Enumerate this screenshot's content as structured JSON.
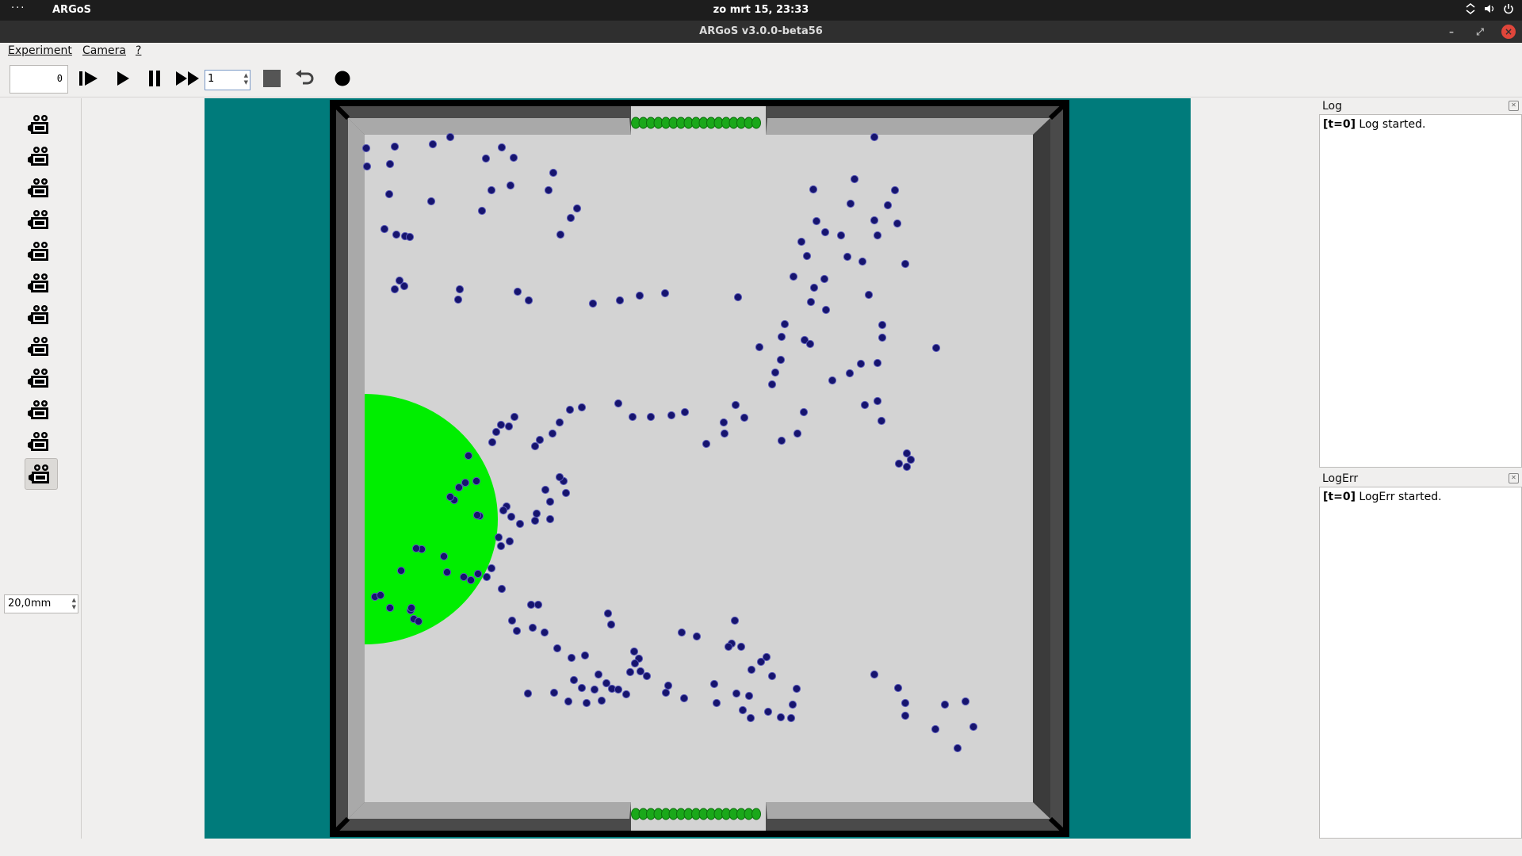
{
  "system_bar": {
    "dots": "···",
    "app_name": "ARGoS",
    "clock": "zo mrt 15, 23:33",
    "tray_icons": [
      "network-icon",
      "volume-icon",
      "power-icon"
    ]
  },
  "window": {
    "title": "ARGoS v3.0.0-beta56",
    "controls": [
      "minimize-icon",
      "maximize-icon",
      "close-icon"
    ]
  },
  "menu": {
    "items": [
      "Experiment",
      "Camera",
      "?"
    ]
  },
  "toolbar": {
    "counter_value": "0",
    "buttons": [
      "step-icon",
      "play-icon",
      "pause-icon",
      "fast-forward-icon",
      "stop-icon",
      "reset-icon",
      "record-icon"
    ],
    "step_value": "1"
  },
  "camera_panel": {
    "camera_count": 12,
    "selected_index": 11,
    "zoom_value": "20,0mm"
  },
  "arena": {
    "background_color": "#007b7b",
    "wall_color": "#4a4a4a",
    "floor_color": "#d3d3d3",
    "robot_color": "#16146e",
    "nest_colors": [
      "#ff1a00",
      "#ffe000",
      "#00ee00"
    ],
    "gate_color": "#1aa81a"
  },
  "log": {
    "title": "Log",
    "prefix": "[t=0]",
    "message": "Log started."
  },
  "log_err": {
    "title": "LogErr",
    "prefix": "[t=0]",
    "message": "LogErr started."
  }
}
